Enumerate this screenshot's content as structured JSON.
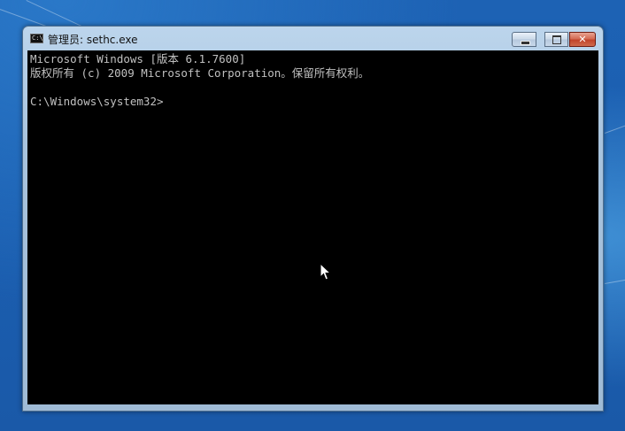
{
  "window": {
    "title": "管理员: sethc.exe",
    "icon": "console-icon",
    "icon_text": "C:\\"
  },
  "controls": {
    "minimize": "minimize-icon",
    "maximize": "maximize-icon",
    "close": "close-icon",
    "close_glyph": "✕"
  },
  "console": {
    "lines": [
      "Microsoft Windows [版本 6.1.7600]",
      "版权所有 (c) 2009 Microsoft Corporation。保留所有权利。",
      "",
      "C:\\Windows\\system32>"
    ]
  },
  "colors": {
    "console_bg": "#000000",
    "console_fg": "#c0c0c0",
    "desktop": "#1d62b4",
    "close_button": "#c1442b"
  }
}
